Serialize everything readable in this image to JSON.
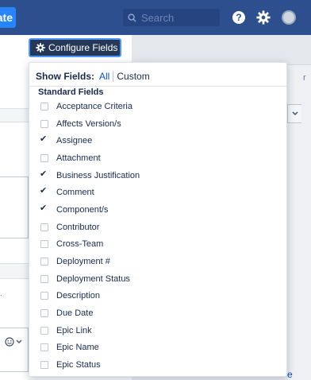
{
  "topbar": {
    "create_label": "ate",
    "search_placeholder": "Search"
  },
  "configure_fields": {
    "button_label": "Configure Fields"
  },
  "popup": {
    "show_fields_label": "Show Fields:",
    "filter_all": "All",
    "filter_custom": "Custom",
    "section_title": "Standard Fields",
    "fields": [
      {
        "label": "Acceptance Criteria",
        "checked": false
      },
      {
        "label": "Affects Version/s",
        "checked": false
      },
      {
        "label": "Assignee",
        "checked": true
      },
      {
        "label": "Attachment",
        "checked": false
      },
      {
        "label": "Business Justification",
        "checked": true
      },
      {
        "label": "Comment",
        "checked": true
      },
      {
        "label": "Component/s",
        "checked": true
      },
      {
        "label": "Contributor",
        "checked": false
      },
      {
        "label": "Cross-Team",
        "checked": false
      },
      {
        "label": "Deployment #",
        "checked": false
      },
      {
        "label": "Deployment Status",
        "checked": false
      },
      {
        "label": "Description",
        "checked": false
      },
      {
        "label": "Due Date",
        "checked": false
      },
      {
        "label": "Epic Link",
        "checked": false
      },
      {
        "label": "Epic Name",
        "checked": false
      },
      {
        "label": "Epic Status",
        "checked": false
      }
    ]
  },
  "background": {
    "right_link": "e"
  },
  "colors": {
    "topbar": "#2e4f8e",
    "config_button": "#253858",
    "focus_ring": "#4c9aff",
    "link": "#0052cc"
  }
}
